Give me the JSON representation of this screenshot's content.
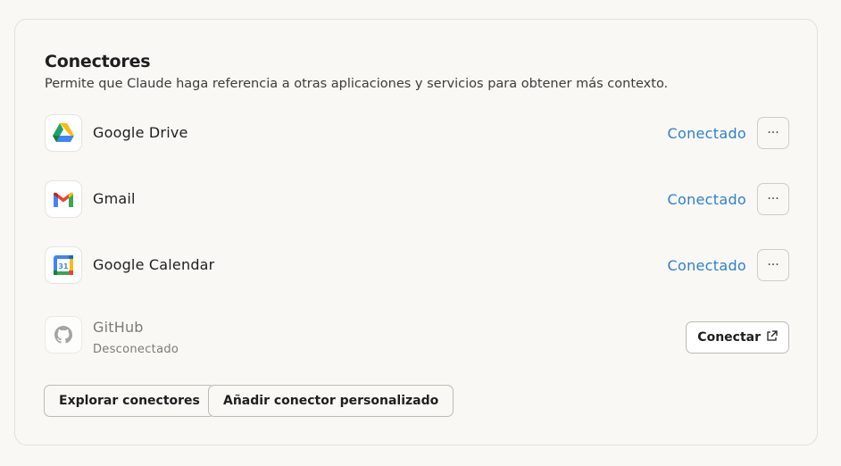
{
  "section": {
    "title": "Conectores",
    "subtitle": "Permite que Claude haga referencia a otras aplicaciones y servicios para obtener más contexto."
  },
  "connectors": [
    {
      "name": "Google Drive",
      "icon": "google-drive-icon",
      "status": "Conectado",
      "menu": "···"
    },
    {
      "name": "Gmail",
      "icon": "gmail-icon",
      "status": "Conectado",
      "menu": "···"
    },
    {
      "name": "Google Calendar",
      "icon": "google-calendar-icon",
      "status": "Conectado",
      "menu": "···",
      "calendar_day": "31"
    },
    {
      "name": "GitHub",
      "icon": "github-icon",
      "status": "Desconectado",
      "action": "Conectar"
    }
  ],
  "actions": {
    "explore": "Explorar conectores",
    "add_custom": "Añadir conector personalizado"
  },
  "colors": {
    "link": "#2f7fce",
    "background": "#f9f8f5",
    "border": "#e3e1da"
  }
}
